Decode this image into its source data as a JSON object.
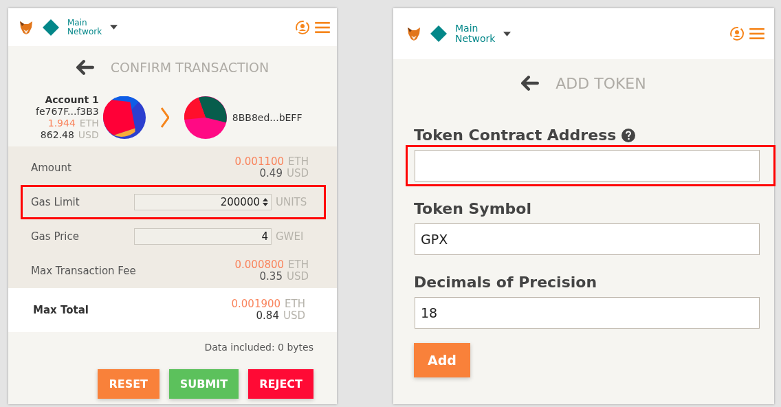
{
  "confirm_transaction": {
    "header": {
      "network_line_1": "Main",
      "network_line_2": "Network"
    },
    "title": "CONFIRM TRANSACTION",
    "sender": {
      "name": "Account 1",
      "address": "fe767F...f3B3",
      "balance": "1.944",
      "balance_unit": "ETH",
      "fiat": "862.48",
      "fiat_unit": "USD"
    },
    "recipient": {
      "address": "8BB8ed...bEFF"
    },
    "rows": [
      {
        "kind": "value",
        "label": "Amount",
        "eth": "0.001100",
        "eth_unit": "ETH",
        "usd": "0.49",
        "usd_unit": "USD",
        "highlighted": false
      },
      {
        "kind": "input",
        "label": "Gas Limit",
        "value": "200000",
        "unit": "UNITS",
        "spinner": true,
        "highlighted": true
      },
      {
        "kind": "input",
        "label": "Gas Price",
        "value": "4",
        "unit": "GWEI",
        "spinner": false,
        "highlighted": false
      },
      {
        "kind": "value",
        "label": "Max Transaction Fee",
        "eth": "0.000800",
        "eth_unit": "ETH",
        "usd": "0.35",
        "usd_unit": "USD",
        "highlighted": false
      },
      {
        "kind": "total",
        "label": "Max Total",
        "eth": "0.001900",
        "eth_unit": "ETH",
        "usd": "0.84",
        "usd_unit": "USD",
        "highlighted": false
      }
    ],
    "data_note": "Data included: 0 bytes",
    "buttons": [
      {
        "label": "RESET",
        "color": "#f9813a"
      },
      {
        "label": "SUBMIT",
        "color": "#5cc15c"
      },
      {
        "label": "REJECT",
        "color": "#ff0a35"
      }
    ]
  },
  "add_token": {
    "header": {
      "network_line_1": "Main",
      "network_line_2": "Network"
    },
    "title": "ADD TOKEN",
    "fields": [
      {
        "label": "Token Contract Address",
        "help": true,
        "highlighted": true
      },
      {
        "label": "Token Symbol",
        "help": false,
        "highlighted": false,
        "value": "GPX"
      },
      {
        "label": "Decimals of Precision",
        "help": false,
        "highlighted": false,
        "value": "18"
      }
    ],
    "button": "Add"
  }
}
